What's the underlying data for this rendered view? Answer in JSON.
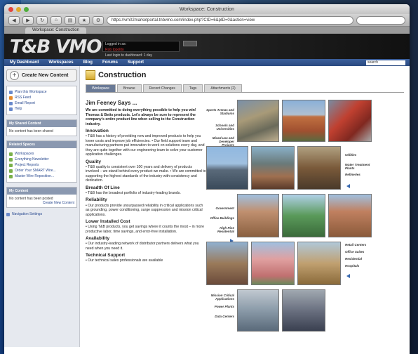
{
  "window": {
    "title": "Workspace: Construction",
    "url": "https://vm02marketportal.tnbvmo.com/index.php?CID=6&pID=0&action=view",
    "tab": "Workspace: Construction"
  },
  "banner": {
    "logo": "T&B VMO",
    "login_line1": "Logged in as:",
    "login_line2": "Rob Ippolito",
    "login_line3": "Last login to dashboard: 1 day"
  },
  "nav": {
    "items": [
      "My Dashboard",
      "Workspaces",
      "Blog",
      "Forums",
      "Support"
    ],
    "search_placeholder": "search"
  },
  "sidebar": {
    "create_label": "Create New Content",
    "links": [
      "Plan this Workspace",
      "RSS Feed",
      "Email Report",
      "Help"
    ],
    "box1_title": "My Shared Content",
    "box1_text": "No content has been shared",
    "box2_title": "Related Spaces",
    "box2_items": [
      "Workspaces",
      "Everything Newsletter",
      "Project Reports",
      "Order Your SMART Wire...",
      "Master Wire Reposition..."
    ],
    "box3_title": "My Content",
    "box3_text": "No content has been posted",
    "box3_link": "Create New Content",
    "settings": "Navigation Settings"
  },
  "page": {
    "title": "Construction",
    "tabs": [
      "Workspace",
      "Browse",
      "Recent Changes",
      "Tags",
      "Attachments (2)"
    ]
  },
  "article": {
    "heading": "Jim Feeney Says ...",
    "intro": "We are committed to doing everything possible to help you win! Thomas & Betts products. Let's always be sure to represent the company's entire product line when selling to the Construction industry.",
    "sections": [
      {
        "title": "Innovation",
        "text": "• T&B has a history of providing new and improved products to help you lower costs and improve job efficiencies. • Our field support team and manufacturing partners put innovation to work on solutions every day, and they are quite together with our engineering team to solve your customer application challenges."
      },
      {
        "title": "Quality",
        "text": "• T&B quality is consistent over 100 years and delivery of products involved – we stand behind every product we make. • We are committed to supporting the highest standards of the industry with consistency and dedication."
      },
      {
        "title": "Breadth Of Line",
        "text": "• T&B has the broadest portfolio of industry-leading brands."
      },
      {
        "title": "Reliability",
        "text": "• Our products provide unsurpassed reliability in critical applications such as grounding, power conditioning, surge suppression and mission critical applications."
      },
      {
        "title": "Lower Installed Cost",
        "text": "• Using T&B products, you get savings where it counts the most – in more productive labor, time savings, and error-free installation."
      },
      {
        "title": "Availability",
        "text": "• Our industry-leading network of distributor partners delivers what you need when you need it."
      },
      {
        "title": "Technical Support",
        "text": "• Our technical sales professionals are available"
      }
    ]
  },
  "gallery": {
    "row1_labels": [
      "Sports Arenas and Stadiums",
      "Schools and Universities",
      "Mixed-use and Developer Projects"
    ],
    "row2_labels": [
      "Utilities",
      "Water Treatment Plants",
      "Refineries"
    ],
    "row3_labels": [
      "Government",
      "Office Buildings",
      "High Rise Residential"
    ],
    "row4_labels": [
      "Retail Centers",
      "Office Suites",
      "Residential",
      "Hospitals"
    ],
    "row5_labels": [
      "Mission Critical Applications",
      "Power Plants",
      "Data Centers"
    ]
  }
}
